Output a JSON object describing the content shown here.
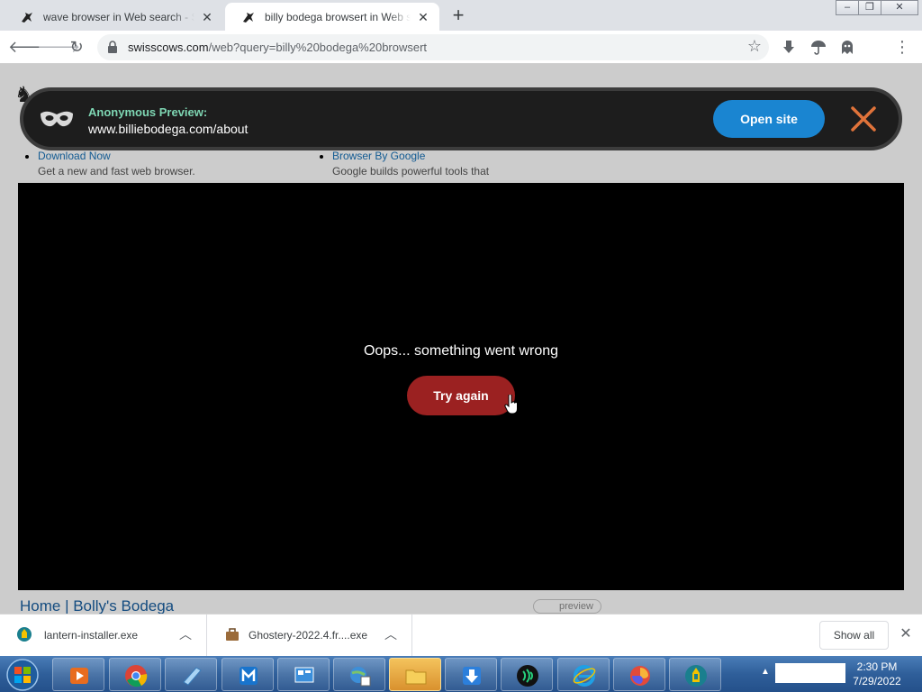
{
  "tabs": [
    {
      "title": "wave browser in Web search - Swisscows",
      "active": false
    },
    {
      "title": "billy bodega browsert in Web search - Swisscows",
      "active": true
    }
  ],
  "window_controls": {
    "minimize": "–",
    "maximize": "❐",
    "close": "✕"
  },
  "toolbar": {
    "url_host": "swisscows.com",
    "url_path": "/web?query=billy%20bodega%20browsert"
  },
  "preview_bar": {
    "label": "Anonymous Preview:",
    "url": "www.billiebodega.com/about",
    "open_button": "Open site"
  },
  "preview_frame": {
    "error_message": "Oops... something went wrong",
    "retry_button": "Try again"
  },
  "background_results": {
    "col1_link": "Download Now",
    "col1_desc": "Get a new and fast web browser.",
    "col2_link": "Browser By Google",
    "col2_desc": "Google builds powerful tools that",
    "home_link": "Home | Bolly's Bodega",
    "preview_tag": "preview"
  },
  "downloads": {
    "items": [
      {
        "name": "lantern-installer.exe"
      },
      {
        "name": "Ghostery-2022.4.fr....exe"
      }
    ],
    "show_all": "Show all"
  },
  "taskbar": {
    "clock_time": "2:30 PM",
    "clock_date": "7/29/2022"
  },
  "colors": {
    "open_site": "#1a85d1",
    "try_again": "#9b2121",
    "anon_label": "#7ed6b3",
    "close_x": "#e0733a"
  }
}
